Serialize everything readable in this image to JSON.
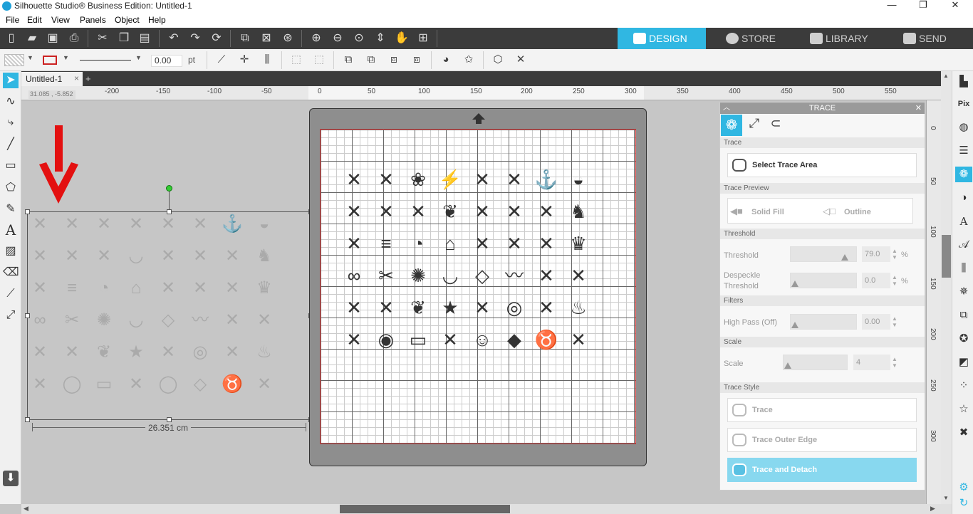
{
  "app": {
    "title": "Silhouette Studio® Business Edition: Untitled-1"
  },
  "window_controls": {
    "minimize": "—",
    "restore": "❐",
    "close": "✕"
  },
  "menu": [
    "File",
    "Edit",
    "View",
    "Panels",
    "Object",
    "Help"
  ],
  "nav_tabs": [
    {
      "label": "DESIGN",
      "active": true
    },
    {
      "label": "STORE",
      "active": false
    },
    {
      "label": "LIBRARY",
      "active": false
    },
    {
      "label": "SEND",
      "active": false
    }
  ],
  "line_style": {
    "width_value": "0.00",
    "unit": "pt"
  },
  "document": {
    "tab_label": "Untitled-1",
    "close": "×",
    "add": "+"
  },
  "ruler": {
    "coords": "31.085 , -5.852",
    "top_ticks": [
      "-200",
      "-150",
      "-100",
      "-50",
      "0",
      "50",
      "100",
      "150",
      "200",
      "250",
      "300",
      "350",
      "400",
      "450",
      "500",
      "550"
    ],
    "right_ticks": [
      "0",
      "50",
      "100",
      "150",
      "200",
      "250",
      "300"
    ]
  },
  "selection": {
    "width_label": "26.351 cm"
  },
  "icon_sheet": {
    "rows": [
      [
        "✕",
        "✕",
        "❀",
        "⚡",
        "✕",
        "✕",
        "⚓",
        "◒"
      ],
      [
        "✕",
        "✕",
        "✕",
        "❦",
        "✕",
        "✕",
        "✕",
        "♞"
      ],
      [
        "✕",
        "≡",
        "◔",
        "⌂",
        "✕",
        "✕",
        "✕",
        "♛"
      ],
      [
        "∞",
        "✂",
        "✺",
        "◡",
        "◇",
        "〰",
        "✕",
        "✕"
      ],
      [
        "✕",
        "✕",
        "❦",
        "★",
        "✕",
        "◎",
        "✕",
        "♨"
      ],
      [
        "✕",
        "◉",
        "▭",
        "✕",
        "☺",
        "◆",
        "♉",
        "✕"
      ]
    ]
  },
  "ghost_sheet": {
    "rows": [
      [
        "✕",
        "✕",
        "✕",
        "✕",
        "✕",
        "✕",
        "⚓",
        "◒"
      ],
      [
        "✕",
        "✕",
        "✕",
        "◡",
        "✕",
        "✕",
        "✕",
        "♞"
      ],
      [
        "✕",
        "≡",
        "◔",
        "⌂",
        "✕",
        "✕",
        "✕",
        "♛"
      ],
      [
        "∞",
        "✂",
        "✺",
        "◡",
        "◇",
        "〰",
        "✕",
        "✕"
      ],
      [
        "✕",
        "✕",
        "❦",
        "★",
        "✕",
        "◎",
        "✕",
        "♨"
      ],
      [
        "✕",
        "◯",
        "▭",
        "✕",
        "◯",
        "◇",
        "♉",
        "✕"
      ]
    ]
  },
  "trace_panel": {
    "title": "TRACE",
    "close": "✕",
    "sections": {
      "trace": "Trace",
      "trace_preview": "Trace Preview",
      "threshold": "Threshold",
      "filters": "Filters",
      "scale": "Scale",
      "trace_style": "Trace Style"
    },
    "select_trace_area": "Select Trace Area",
    "preview_options": [
      "Solid Fill",
      "Outline"
    ],
    "threshold_label": "Threshold",
    "threshold_value": "79.0",
    "threshold_level": 0.79,
    "threshold_unit": "%",
    "despeckle_label_1": "Despeckle",
    "despeckle_label_2": "Threshold",
    "despeckle_value": "0.0",
    "despeckle_unit": "%",
    "high_pass_label": "High Pass (Off)",
    "high_pass_value": "0.00",
    "scale_label": "Scale",
    "scale_value": "4",
    "trace_buttons": [
      "Trace",
      "Trace Outer Edge",
      "Trace and Detach"
    ]
  },
  "colors": {
    "accent": "#30b7e2",
    "arrow": "#e31010",
    "panel_active": "#88d8ef"
  }
}
